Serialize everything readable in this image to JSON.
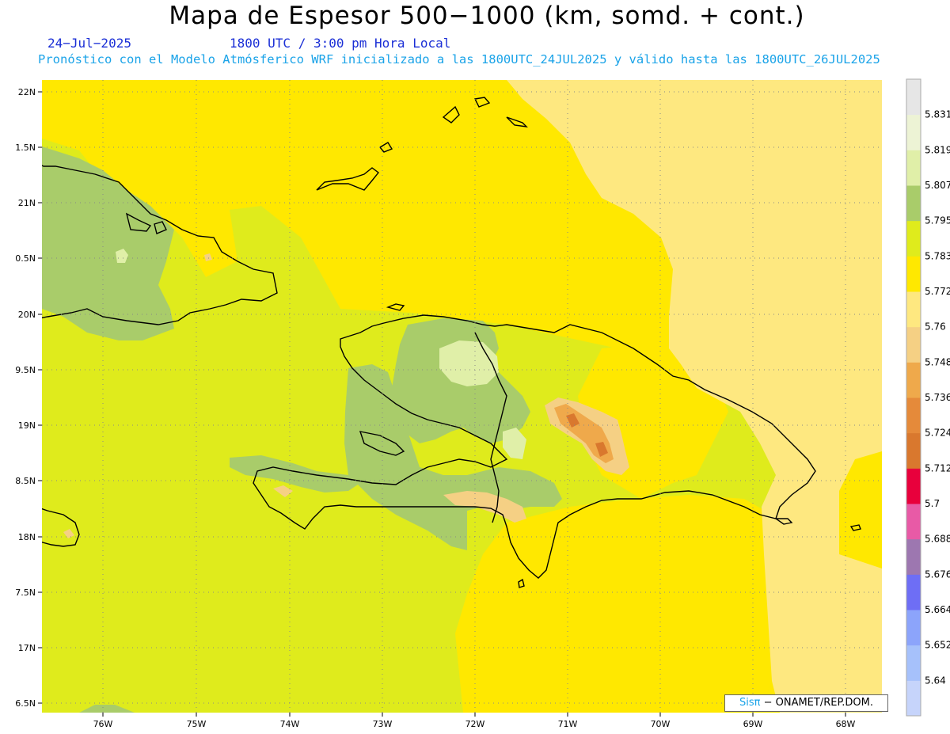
{
  "title": "Mapa de Espesor 500−1000 (km, somd. + cont.)",
  "date": "24−Jul−2025",
  "time": "1800 UTC / 3:00 pm Hora Local",
  "description": "Pronóstico con el Modelo Atmósferico WRF inicializado a las 1800UTC_24JUL2025 y válido hasta las  1800UTC_26JUL2025",
  "credit": {
    "brand": "Sisπ",
    "text": "− ONAMET/REP.DOM."
  },
  "axes": {
    "lat_labels": [
      "22N",
      "1.5N",
      "21N",
      "0.5N",
      "20N",
      "9.5N",
      "19N",
      "8.5N",
      "18N",
      "7.5N",
      "17N",
      "6.5N"
    ],
    "lon_labels": [
      "76W",
      "75W",
      "74W",
      "73W",
      "72W",
      "71W",
      "70W",
      "69W",
      "68W"
    ]
  },
  "legend": {
    "labels": [
      "5.831",
      "5.819",
      "5.807",
      "5.795",
      "5.783",
      "5.772",
      "5.76",
      "5.748",
      "5.736",
      "5.724",
      "5.712",
      "5.7",
      "5.688",
      "5.676",
      "5.664",
      "5.652",
      "5.64"
    ],
    "colors": [
      "#e6e6e6",
      "#edf3d5",
      "#e0efa8",
      "#a9cc6a",
      "#dfeb1c",
      "#ffe800",
      "#fee880",
      "#f5d084",
      "#efa94b",
      "#e58a3a",
      "#d9782e",
      "#e8003c",
      "#e85aa6",
      "#9d77b0",
      "#6e6ef5",
      "#8ca4fb",
      "#a6c1fb",
      "#c6d4fb"
    ]
  },
  "colors": {
    "ocean_base": "#dfeb1c",
    "band_5772": "#ffe800",
    "band_5760": "#fee880",
    "band_5795": "#a9cc6a",
    "band_5807": "#e0efa8",
    "band_5748": "#f5d084",
    "band_5736": "#efa94b",
    "band_5724": "#d9782e",
    "title_blue": "#1b2fd6",
    "desc_blue": "#1aa3e8"
  }
}
